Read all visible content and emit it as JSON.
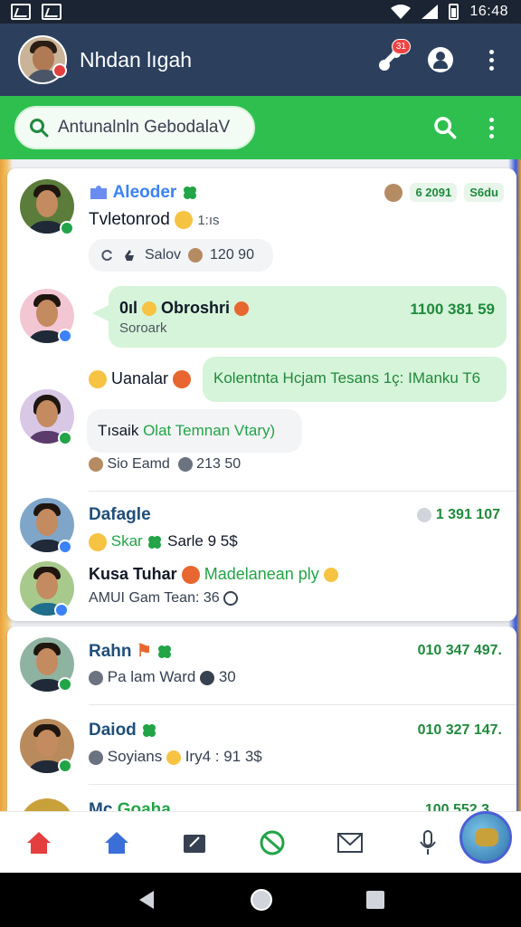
{
  "status_bar": {
    "time": "16:48"
  },
  "header": {
    "title": "Nhdan lıgah",
    "notification_count": "31"
  },
  "search": {
    "placeholder": "Antunalnln GebodalaV"
  },
  "colors": {
    "header_bg": "#2c405e",
    "search_band": "#2fbf4f",
    "accent_green": "#22a447",
    "bubble_green": "#d6f4d9"
  },
  "chats_card1": {
    "item1": {
      "name": "Aleoder",
      "chip1": "6 2091",
      "chip2": "S6du",
      "message": "Tvletonrod",
      "message_suffix": "1:ıs",
      "tag_label": "Salov",
      "tag_count": "120 90"
    },
    "item2": {
      "title": "Obroshri",
      "prefix": "0ıl",
      "subtitle": "Soroark",
      "time": "1100 381 59"
    },
    "item3": {
      "left_label": "Uanalar",
      "bubble": "Kolentnta Hcjam Tesans 1ç: IManku T6",
      "reply_prefix": "Tısaik",
      "reply_green": "Olat Temnan Vtary)",
      "meta_name": "Sio Eamd",
      "meta_time": "213 50"
    }
  },
  "chats_card2": {
    "item1": {
      "name": "Dafagle",
      "time": "1 391 107",
      "line_green": "Skar",
      "line_dark": "Sarle 9 5$"
    },
    "item2": {
      "name_bold": "Kusa Tuhar",
      "name_green": "Madelanean ply",
      "meta": "AMUI Gam Tean: 36"
    }
  },
  "chats_card3": [
    {
      "name": "Rahn",
      "time": "010 347 497.",
      "preview": "Pa lam Ward",
      "preview_suffix": "30"
    },
    {
      "name": "Daiod",
      "time": "010 327 147.",
      "preview": "Soyians",
      "preview_suffix": "Iry4 : 91 3$"
    },
    {
      "name": "Mc",
      "name_green": "Goaha",
      "time": "100 552 3"
    }
  ],
  "bottom_nav": [
    "home-red",
    "home-blue",
    "folder",
    "no-symbol",
    "mail",
    "mic"
  ]
}
